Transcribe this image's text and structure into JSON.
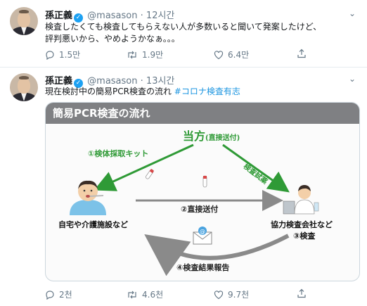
{
  "tweets": [
    {
      "name": "孫正義",
      "handle": "@masason",
      "dot": "·",
      "time": "12시간",
      "text_line1": "検査したくても検査してもらえない人が多数いると聞いて発案したけど、",
      "text_line2": "評判悪いから、やめようかなぁ。。。",
      "replies": "1.5만",
      "retweets": "1.9만",
      "likes": "6.4만"
    },
    {
      "name": "孫正義",
      "handle": "@masason",
      "dot": "·",
      "time": "13시간",
      "text": "現在検討中の簡易PCR検査の流れ",
      "hashtag": "#コロナ検査有志",
      "replies": "2천",
      "retweets": "4.6천",
      "likes": "9.7천",
      "card": {
        "title": "簡易PCR検査の流れ",
        "center_top": "当方",
        "center_top_sub": "(直接送付)",
        "left_arrow_label": "①検体採取キット",
        "right_arrow_label": "検査試薬",
        "middle_arrow_label": "②直接送付",
        "left_node_label": "自宅や介護施設など",
        "right_node_label1": "協力検査会社など",
        "right_node_label2": "③検査",
        "bottom_arrow_label": "④検査結果報告"
      }
    }
  ],
  "colors": {
    "green": "#2f9a36",
    "arrow_gray": "#8a8a8a",
    "card_title_bg": "#7f8083",
    "link": "#1b95e0",
    "muted": "#657786"
  }
}
